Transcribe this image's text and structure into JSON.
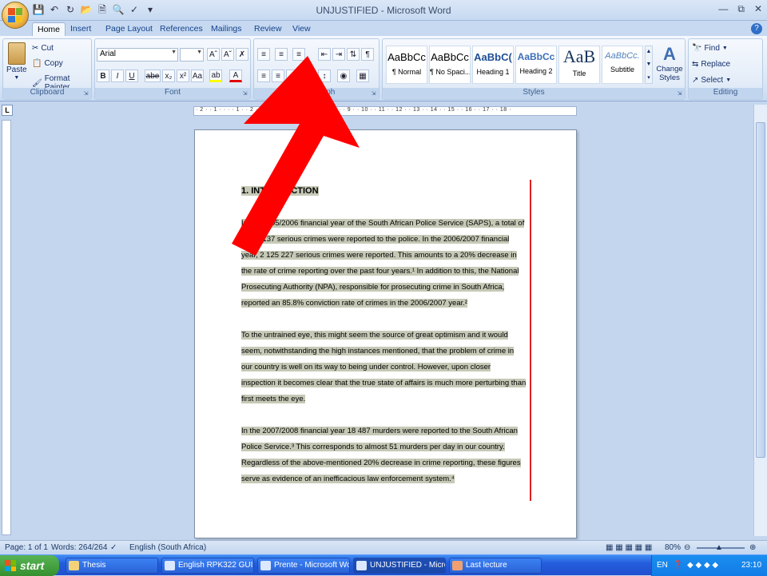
{
  "window": {
    "title": "UNJUSTIFIED - Microsoft Word"
  },
  "qat": [
    "save-icon",
    "undo-icon",
    "redo-icon",
    "open-icon",
    "new-icon",
    "print-preview-icon",
    "spelling-icon"
  ],
  "tabs": [
    "Home",
    "Insert",
    "Page Layout",
    "References",
    "Mailings",
    "Review",
    "View"
  ],
  "active_tab": "Home",
  "clipboard": {
    "label": "Clipboard",
    "paste": "Paste",
    "cut": "Cut",
    "copy": "Copy",
    "format_painter": "Format Painter"
  },
  "font": {
    "label": "Font",
    "family": "Arial",
    "size": "",
    "buttons": [
      "B",
      "I",
      "U",
      "abe",
      "x₂",
      "x²",
      "Aa"
    ]
  },
  "paragraph": {
    "label": "Paragraph"
  },
  "styles": {
    "label": "Styles",
    "items": [
      {
        "sample": "AaBbCc",
        "name": "¶ Normal"
      },
      {
        "sample": "AaBbCc",
        "name": "¶ No Spaci..."
      },
      {
        "sample": "AaBbC(",
        "name": "Heading 1"
      },
      {
        "sample": "AaBbCc",
        "name": "Heading 2"
      },
      {
        "sample": "AaB",
        "name": "Title"
      },
      {
        "sample": "AaBbCc.",
        "name": "Subtitle"
      }
    ],
    "change_styles": "Change Styles"
  },
  "editing": {
    "label": "Editing",
    "find": "Find",
    "replace": "Replace",
    "select": "Select"
  },
  "ruler": "· 2 · · 1 · · · · 1 · · 2 · · 3 · · 4 · · 5 · · 6 · · 7 · · 8 · · 9 · · 10 · · 11 · · 12 · · 13 · · 14 · · 15 · · 16 · · 17 · · 18 ·",
  "document": {
    "heading": "1.    INTRODUCTION",
    "p1": [
      "In the 2005/2006 financial year of the South African Police Service (SAPS), a total of",
      "2 629 137 serious crimes were reported to the police. In the 2006/2007 financial",
      "year, 2 125 227 serious crimes were reported. This amounts to a 20% decrease in",
      "the rate of crime reporting over the past four years.¹ In addition to this, the National",
      "Prosecuting Authority (NPA), responsible for prosecuting crime in South Africa,",
      "reported an 85.8% conviction rate of crimes in the 2006/2007 year.²"
    ],
    "p2": [
      "To the untrained eye, this might seem the source of great optimism and it would",
      "seem, notwithstanding the high instances mentioned, that the problem of crime in",
      "our country is well on its way to being under control. However, upon closer",
      "inspection it becomes clear that the true state of affairs is much more perturbing than",
      "first meets the eye."
    ],
    "p3": [
      "In the 2007/2008 financial year 18 487 murders were reported to the South African",
      "Police Service.³ This corresponds to almost 51 murders per day in our country.",
      "Regardless of the above-mentioned 20% decrease in crime reporting, these figures",
      "serve as evidence of an inefficacious law enforcement system.⁴"
    ]
  },
  "status": {
    "page": "Page: 1 of 1",
    "words": "Words: 264/264",
    "language": "English (South Africa)",
    "zoom": "80%"
  },
  "taskbar": {
    "start": "start",
    "tasks": [
      "Thesis",
      "English RPK322 GUID...",
      "Prente - Microsoft Word",
      "UNJUSTIFIED - Micro...",
      "Last lecture"
    ],
    "lang": "EN",
    "time": "23:10"
  },
  "colors": {
    "highlight": "#c6c9b6",
    "arrow": "#ff0000",
    "redline": "#e02020"
  }
}
